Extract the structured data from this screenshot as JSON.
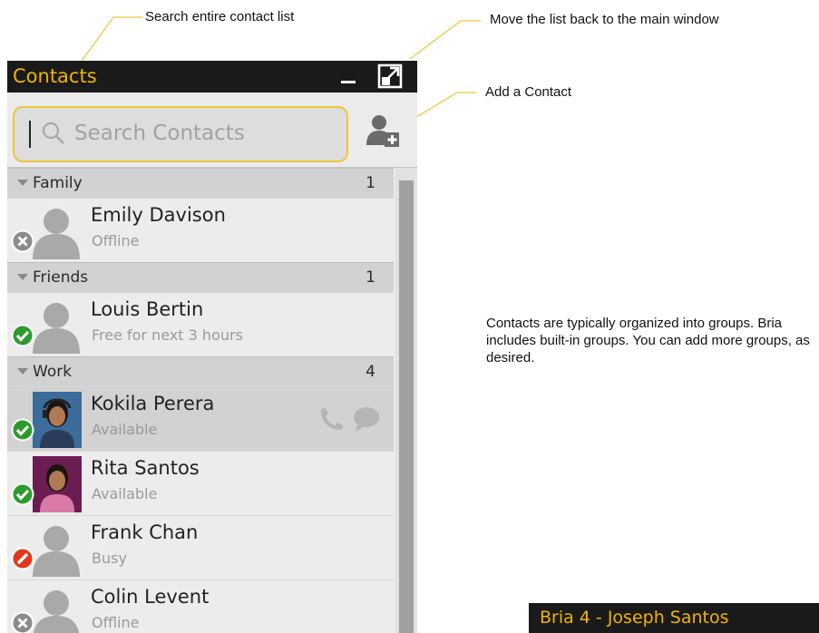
{
  "annotations": {
    "search_callout": "Search entire contact list",
    "popout_callout": "Move the list back to the main window",
    "add_callout": "Add a Contact",
    "groups_callout": "Contacts are typically organized into groups. Bria includes built-in groups. You can add more groups, as desired."
  },
  "panel": {
    "title": "Contacts",
    "search": {
      "placeholder": "Search Contacts",
      "value": ""
    },
    "icons": {
      "minimize": "minimize-icon",
      "popout": "popout-icon",
      "add": "add-contact-icon",
      "search": "search-icon"
    }
  },
  "groups": [
    {
      "name": "Family",
      "count": "1",
      "contacts": [
        {
          "name": "Emily Davison",
          "status": "Offline",
          "presence": "offline",
          "avatar": "generic"
        }
      ]
    },
    {
      "name": "Friends",
      "count": "1",
      "contacts": [
        {
          "name": "Louis Bertin",
          "status": "Free for next 3 hours",
          "presence": "available",
          "avatar": "generic"
        }
      ]
    },
    {
      "name": "Work",
      "count": "4",
      "contacts": [
        {
          "name": "Kokila Perera",
          "status": "Available",
          "presence": "available",
          "avatar": "photo",
          "selected": true
        },
        {
          "name": "Rita Santos",
          "status": "Available",
          "presence": "available",
          "avatar": "photo"
        },
        {
          "name": "Frank Chan",
          "status": "Busy",
          "presence": "busy",
          "avatar": "generic"
        },
        {
          "name": "Colin Levent",
          "status": "Offline",
          "presence": "offline",
          "avatar": "generic"
        }
      ]
    }
  ],
  "bria_window": {
    "title": "Bria 4 - Joseph Santos"
  },
  "colors": {
    "accent": "#f0b400",
    "available": "#2e9a2e",
    "busy": "#e0371e",
    "offline": "#8c8c8c"
  }
}
